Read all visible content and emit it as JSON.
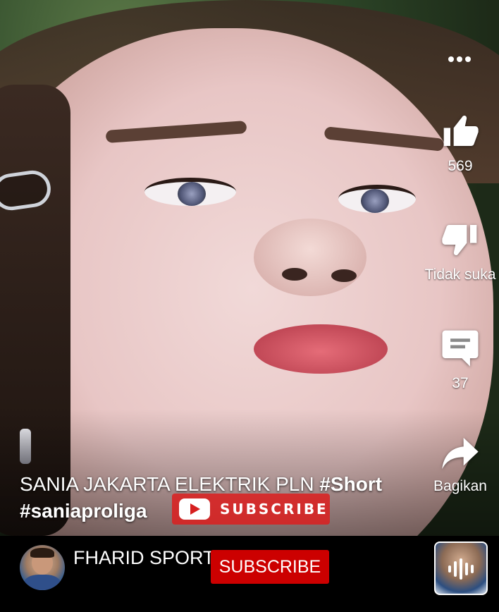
{
  "actions": {
    "like_count": "569",
    "dislike_label": "Tidak suka",
    "comment_count": "37",
    "share_label": "Bagikan"
  },
  "caption": {
    "text": "SANIA JAKARTA ELEKTRIK PLN ",
    "hashtag_1": "#Short",
    "hashtag_2": "#saniaproliga"
  },
  "video_overlay": {
    "subscribe_text": "SUBSCRIBE"
  },
  "channel": {
    "name": "FHARID SPORT",
    "subscribe_label": "SUBSCRIBE"
  },
  "colors": {
    "subscribe_red": "#cc0000",
    "text": "#ffffff"
  }
}
